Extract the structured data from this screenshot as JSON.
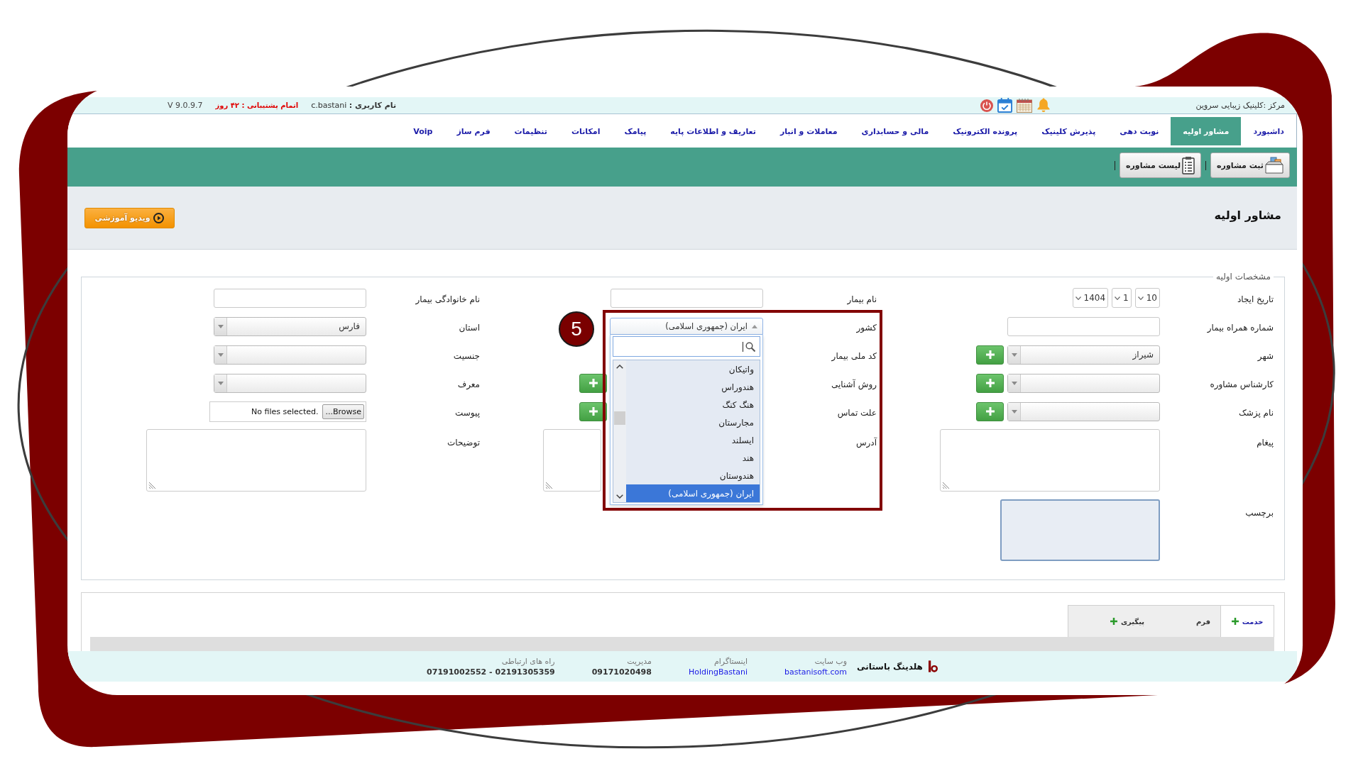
{
  "top_bar": {
    "center_name": "مرکز :کلینیک زیبایی سروین",
    "user": "**نام کاربری :** c.bastani",
    "support": "اتمام پشتیبانی : ۴۲ روز",
    "version": "V 9.0.9.7"
  },
  "nav": [
    {
      "label": "داشبورد",
      "selected": false
    },
    {
      "label": "مشاور اولیه",
      "selected": true
    },
    {
      "label": "نوبت دهی",
      "selected": false
    },
    {
      "label": "پذیرش کلینیک",
      "selected": false
    },
    {
      "label": "پرونده الکترونیک",
      "selected": false
    },
    {
      "label": "مالی و حسابداری",
      "selected": false
    },
    {
      "label": "معاملات و انبار",
      "selected": false
    },
    {
      "label": "تعاریف و اطلاعات پایه",
      "selected": false
    },
    {
      "label": "پیامک",
      "selected": false
    },
    {
      "label": "امکانات",
      "selected": false
    },
    {
      "label": "تنظیمات",
      "selected": false
    },
    {
      "label": "فرم ساز",
      "selected": false
    },
    {
      "label": "Voip",
      "selected": false
    }
  ],
  "toolbar": [
    {
      "label": "ثبت مشاوره",
      "kind": "new"
    },
    {
      "label": "لیست مشاوره",
      "kind": "list"
    }
  ],
  "page_header": {
    "title": "مشاور اولیه",
    "video_button": "ویدیو آموزشی"
  },
  "form": {
    "legend": "مشخصات اولیه",
    "columns": [
      {
        "fields": [
          {
            "label": "تاریخ ایجاد",
            "kind": "date",
            "parts": [
              "10",
              "1",
              "1404"
            ]
          },
          {
            "label": "شماره همراه بیمار",
            "kind": "text"
          },
          {
            "label": "شهر",
            "kind": "select",
            "value": "شیراز",
            "add_button": true
          },
          {
            "label": "کارشناس مشاوره",
            "kind": "select",
            "add_button": true
          },
          {
            "label": "نام پزشک",
            "kind": "select",
            "add_button": true
          },
          {
            "label": "پیغام",
            "kind": "textarea"
          },
          {
            "label": "برچسب",
            "kind": "tags"
          }
        ]
      },
      {
        "fields": [
          {
            "label": "نام بیمار",
            "kind": "text"
          },
          {
            "label": "کشور",
            "kind": "open_select",
            "value": "ایران (جمهوری اسلامی)",
            "options": [
              {
                "label": "واتیکان",
                "selected": false
              },
              {
                "label": "هندوراس",
                "selected": false
              },
              {
                "label": "هنگ کنگ",
                "selected": false
              },
              {
                "label": "مجارستان",
                "selected": false
              },
              {
                "label": "ایسلند",
                "selected": false
              },
              {
                "label": "هند",
                "selected": false
              },
              {
                "label": "هندوستان",
                "selected": false
              },
              {
                "label": "ایران (جمهوری اسلامی)",
                "selected": true
              }
            ]
          },
          {
            "label": "کد ملی بیمار",
            "kind": "covered"
          },
          {
            "label": "روش آشنایی",
            "kind": "covered",
            "add_button": true
          },
          {
            "label": "علت تماس",
            "kind": "covered",
            "add_button": true
          },
          {
            "label": "آدرس",
            "kind": "covered_textarea"
          }
        ]
      },
      {
        "fields": [
          {
            "label": "نام خانوادگی بیمار",
            "kind": "text"
          },
          {
            "label": "استان",
            "kind": "select",
            "value": "فارس"
          },
          {
            "label": "جنسیت",
            "kind": "select"
          },
          {
            "label": "معرف",
            "kind": "select"
          },
          {
            "label": "پیوست",
            "kind": "file",
            "button": "...Browse",
            "status": "No files selected."
          },
          {
            "label": "توضیحات",
            "kind": "textarea"
          }
        ]
      }
    ]
  },
  "annotation": {
    "number": "5"
  },
  "bottom_tabs": [
    {
      "label": "خدمت",
      "selected": true,
      "add_icon": true
    },
    {
      "label": "فرم",
      "selected": false
    },
    {
      "label": "پیگیری",
      "selected": false,
      "add_icon": true
    }
  ],
  "footer": {
    "company": "هلدینگ باستانی",
    "contacts": [
      {
        "title": "وب سایت",
        "value": "bastanisoft.com",
        "kind": "link"
      },
      {
        "title": "اینستاگرام",
        "value": "HoldingBastani",
        "kind": "link"
      },
      {
        "title": "مدیریت",
        "value": "09171020498",
        "kind": "text"
      },
      {
        "title": "راه های ارتباطی",
        "value": "07191002552 - 02191305359",
        "kind": "text"
      }
    ]
  }
}
